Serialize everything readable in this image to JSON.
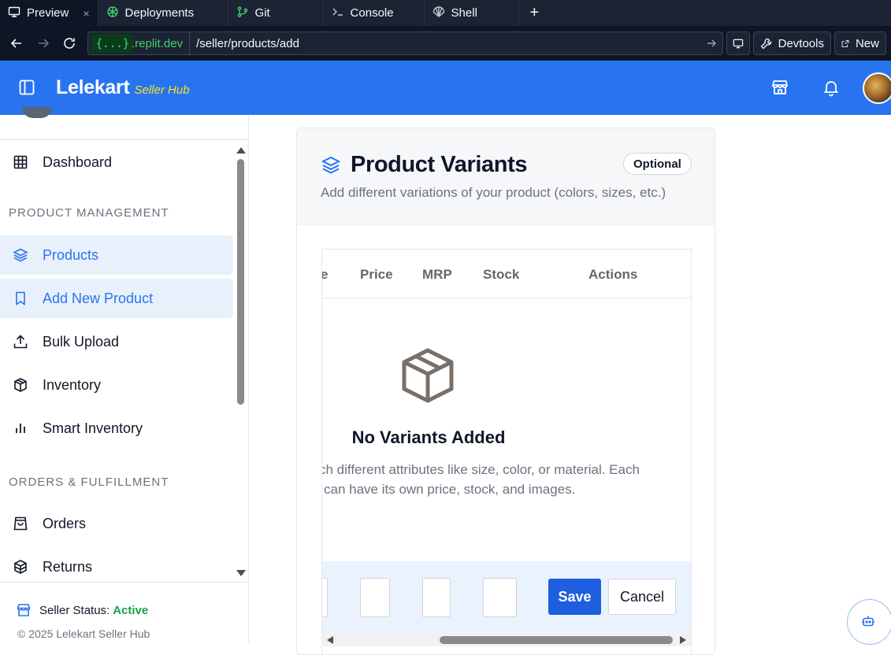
{
  "browser": {
    "tabs": [
      {
        "label": "Preview",
        "icon": "monitor-icon",
        "active": true,
        "closable": true
      },
      {
        "label": "Deployments",
        "icon": "deployments-icon"
      },
      {
        "label": "Git",
        "icon": "git-icon"
      },
      {
        "label": "Console",
        "icon": "terminal-icon"
      },
      {
        "label": "Shell",
        "icon": "shell-icon"
      }
    ],
    "new_tab_label": "+",
    "close_label": "×",
    "url_host": "{...}",
    "url_host_suffix": ".replit.dev",
    "url_path": "/seller/products/add",
    "devtools_label": "Devtools",
    "new_label": "New"
  },
  "header": {
    "brand": "Lelekart",
    "brand_sub": "Seller Hub",
    "accent": "#2874f0",
    "sub_color": "#ffe11b"
  },
  "sidebar": {
    "dashboard": "Dashboard",
    "section_product": "PRODUCT MANAGEMENT",
    "products": "Products",
    "add_new_product": "Add New Product",
    "bulk_upload": "Bulk Upload",
    "inventory": "Inventory",
    "smart_inventory": "Smart Inventory",
    "section_orders": "ORDERS & FULFILLMENT",
    "orders": "Orders",
    "returns": "Returns",
    "seller_status_label": "Seller Status:",
    "seller_status_value": "Active",
    "copyright": "© 2025 Lelekart Seller Hub"
  },
  "card": {
    "title": "Product Variants",
    "badge": "Optional",
    "description": "Add different variations of your product (colors, sizes, etc.)",
    "table_headers": [
      "e",
      "Price",
      "MRP",
      "Stock",
      "Actions"
    ],
    "empty_title": "No Variants Added",
    "empty_line1": "ch different attributes like size, color, or material. Each",
    "empty_line2": "can have its own price, stock, and images.",
    "save_label": "Save",
    "cancel_label": "Cancel"
  }
}
